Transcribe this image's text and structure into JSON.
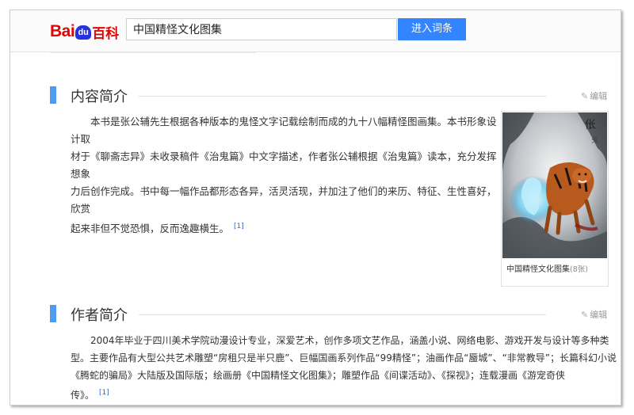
{
  "header": {
    "logo_bai": "Bai",
    "logo_du": "du",
    "logo_baike": "百科",
    "search_value": "中国精怪文化图集",
    "search_button": "进入词条"
  },
  "sections": [
    {
      "title": "内容简介",
      "edit": "编辑",
      "lines": [
        "本书是张公辅先生根据各种版本的鬼怪文字记载绘制而成的九十八幅精怪图画集。本书形象设计取",
        "材于《聊斋志异》未收录稿件《治鬼篇》中文字描述，作者张公辅根据《治鬼篇》读本，充分发挥想象",
        "力后创作完成。书中每一幅作品都形态各异，活灵活现，并加注了他们的来历、特征、生性喜好，欣赏",
        "起来非但不觉恐惧，反而逸趣横生。"
      ],
      "citation": "[1]"
    },
    {
      "title": "作者简介",
      "edit": "编辑",
      "lines": [
        "2004年毕业于四川美术学院动漫设计专业，深爱艺术，创作多项文艺作品，涵盖小说、网络电影、游戏开发与设计等多种类",
        "型。主要作品有大型公共艺术雕塑“房租只是半只鹿”、巨幅国画系列作品“99精怪”；油画作品“蜃城”、“非常教导”；长篇科幻小说",
        "《腾蛇的骗局》大陆版及国际版；绘画册《中国精怪文化图集》；雕塑作品《间谍活动》、《探视》；连载漫画《游宠奇侠",
        "传》。"
      ],
      "citation": "[1]"
    }
  ],
  "figure": {
    "caption": "中国精怪文化图集",
    "count": "(8张)"
  }
}
